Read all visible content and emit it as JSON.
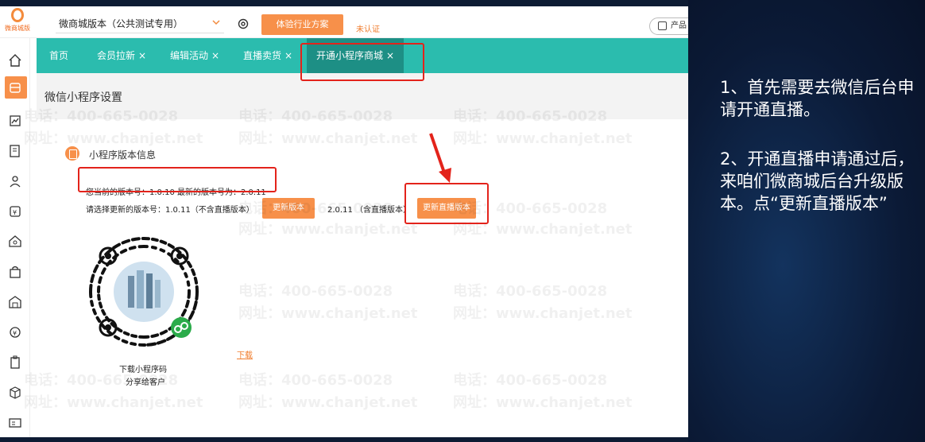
{
  "app": {
    "logo_text": "微商城版",
    "version_select": "微商城版本（公共测试专用）",
    "top_cta": "体验行业方案",
    "unverified": "未认证",
    "product": "产品"
  },
  "tabs": [
    {
      "label": "首页",
      "closable": false
    },
    {
      "label": "会员拉新",
      "closable": true
    },
    {
      "label": "编辑活动",
      "closable": true
    },
    {
      "label": "直播卖货",
      "closable": true
    },
    {
      "label": "开通小程序商城",
      "closable": true,
      "active": true
    }
  ],
  "close_glyph": "×",
  "page": {
    "title": "微信小程序设置",
    "section_title": "小程序版本信息",
    "version_line": "您当前的版本号：1.0.10  最新的版本号为：2.0.11",
    "select_line": "请选择更新的版本号：1.0.11（不含直播版本）",
    "update_button": "更新版本",
    "version2_line": "2.0.11 （含直播版本）",
    "live_button": "更新直播版本",
    "download_link": "下载",
    "qr_caption1": "下载小程序码",
    "qr_caption2": "分享给客户"
  },
  "watermark": {
    "phone": "电话：400-665-0028",
    "site": "网址：www.chanjet.net"
  },
  "notes": {
    "step1": "1、首先需要去微信后台申请开通直播。",
    "step2": "2、开通直播申请通过后，来咱们微商城后台升级版本。点“更新直播版本”"
  },
  "colors": {
    "accent_orange": "#f7904a",
    "tab_teal": "#2bbcae",
    "tab_active": "#1d8f85",
    "highlight_red": "#e3231b"
  },
  "icons": [
    "home-icon",
    "store-icon",
    "chart-icon",
    "order-icon",
    "member-icon",
    "coupon-icon",
    "shop-icon",
    "bag-icon",
    "warehouse-icon",
    "finance-icon",
    "clipboard-icon",
    "box-icon",
    "card-icon"
  ]
}
